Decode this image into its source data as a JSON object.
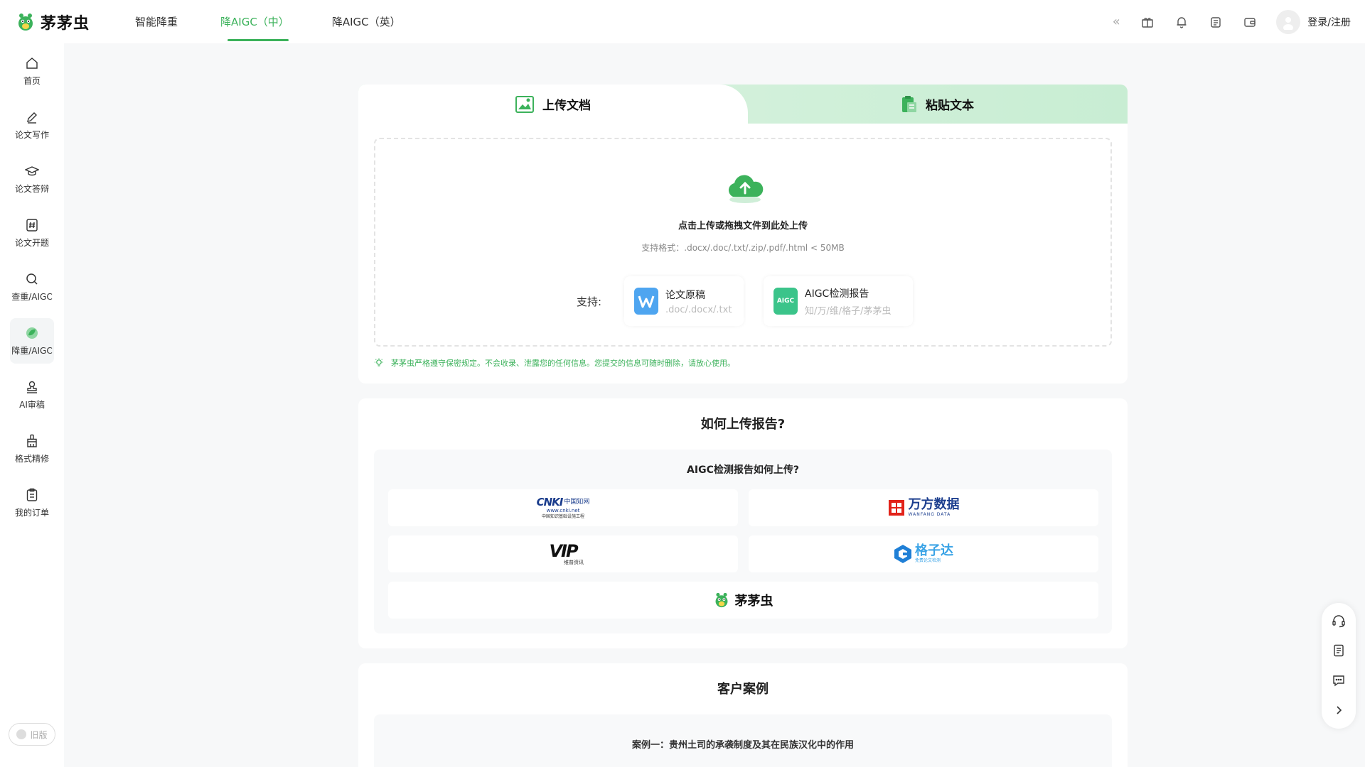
{
  "brand": {
    "name": "茅茅虫",
    "accent": "#3cb25b"
  },
  "nav": {
    "tabs": [
      {
        "label": "智能降重"
      },
      {
        "label": "降AIGC（中）",
        "active": true
      },
      {
        "label": "降AIGC（英）"
      }
    ]
  },
  "header": {
    "login_label": "登录/注册",
    "icons": [
      "collapse-chevron-icon",
      "gift-icon",
      "bell-icon",
      "clipboard-icon",
      "wallet-icon"
    ]
  },
  "sidebar": {
    "items": [
      {
        "label": "首页",
        "icon": "home-icon"
      },
      {
        "label": "论文写作",
        "icon": "pen-icon"
      },
      {
        "label": "论文答辩",
        "icon": "graduation-cap-icon"
      },
      {
        "label": "论文开题",
        "icon": "hash-doc-icon"
      },
      {
        "label": "查重/AIGC",
        "icon": "search-icon"
      },
      {
        "label": "降重/AIGC",
        "icon": "leaf-icon",
        "active": true
      },
      {
        "label": "AI审稿",
        "icon": "stamp-icon"
      },
      {
        "label": "格式精修",
        "icon": "brush-icon"
      },
      {
        "label": "我的订单",
        "icon": "order-icon"
      }
    ],
    "old_version_label": "旧版"
  },
  "upload": {
    "tab_upload": "上传文档",
    "tab_paste": "粘贴文本",
    "drop_title": "点击上传或拖拽文件到此处上传",
    "drop_formats": "支持格式：.docx/.doc/.txt/.zip/.pdf/.html < 50MB",
    "support_label": "支持:",
    "support_items": [
      {
        "title": "论文原稿",
        "sub": ".doc/.docx/.txt"
      },
      {
        "title": "AIGC检测报告",
        "sub": "知/万/维/格子/茅茅虫"
      }
    ],
    "aigc_badge": "AIGC",
    "notice": "茅茅虫严格遵守保密规定。不会收录、泄露您的任何信息。您提交的信息可随时删除，请放心使用。"
  },
  "howto": {
    "title": "如何上传报告?",
    "panel_title": "AIGC检测报告如何上传?",
    "logos": {
      "cnki_main": "CNKI",
      "cnki_cn": "中国知网",
      "cnki_url": "www.cnki.net",
      "cnki_tagline": "中国知识基础设施工程",
      "wanfang_name": "万方数据",
      "wanfang_en": "WANFANG DATA",
      "vip_main": "VIP",
      "vip_sub": "维普资讯",
      "gezida_name": "格子达",
      "gezida_sub": "免费论文检测",
      "mmc_name": "茅茅虫"
    }
  },
  "cases": {
    "title": "客户案例",
    "case1": "案例一：贵州土司的承袭制度及其在民族汉化中的作用"
  },
  "floatbar": {
    "icons": [
      "headset-icon",
      "document-icon",
      "chat-icon",
      "chevron-right-icon"
    ]
  }
}
